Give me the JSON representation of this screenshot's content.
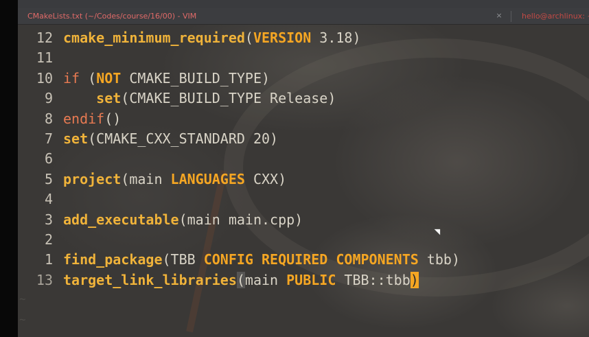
{
  "window": {
    "title": "CMakeLists.txt (~/Codes/course/16/00) - VIM",
    "close_icon": "×",
    "second_tab": "hello@archlinux: ~/Co"
  },
  "editor": {
    "lines": [
      {
        "num": "12",
        "tokens": [
          {
            "cls": "fn",
            "text": "cmake_minimum_required"
          },
          {
            "cls": "plain",
            "text": "("
          },
          {
            "cls": "kw",
            "text": "VERSION"
          },
          {
            "cls": "plain",
            "text": " 3.18)"
          }
        ]
      },
      {
        "num": "11",
        "tokens": []
      },
      {
        "num": "10",
        "tokens": [
          {
            "cls": "ifkw",
            "text": "if"
          },
          {
            "cls": "plain",
            "text": " ("
          },
          {
            "cls": "kw",
            "text": "NOT"
          },
          {
            "cls": "plain",
            "text": " CMAKE_BUILD_TYPE)"
          }
        ]
      },
      {
        "num": "9",
        "tokens": [
          {
            "cls": "plain",
            "text": "    "
          },
          {
            "cls": "fn",
            "text": "set"
          },
          {
            "cls": "plain",
            "text": "(CMAKE_BUILD_TYPE Release)"
          }
        ]
      },
      {
        "num": "8",
        "tokens": [
          {
            "cls": "ifkw",
            "text": "endif"
          },
          {
            "cls": "plain",
            "text": "()"
          }
        ]
      },
      {
        "num": "7",
        "tokens": [
          {
            "cls": "fn",
            "text": "set"
          },
          {
            "cls": "plain",
            "text": "(CMAKE_CXX_STANDARD 20)"
          }
        ]
      },
      {
        "num": "6",
        "tokens": []
      },
      {
        "num": "5",
        "tokens": [
          {
            "cls": "fn",
            "text": "project"
          },
          {
            "cls": "plain",
            "text": "(main "
          },
          {
            "cls": "kw",
            "text": "LANGUAGES"
          },
          {
            "cls": "plain",
            "text": " CXX)"
          }
        ]
      },
      {
        "num": "4",
        "tokens": []
      },
      {
        "num": "3",
        "tokens": [
          {
            "cls": "fn",
            "text": "add_executable"
          },
          {
            "cls": "plain",
            "text": "(main main.cpp)"
          }
        ]
      },
      {
        "num": "2",
        "tokens": []
      },
      {
        "num": "1",
        "tokens": [
          {
            "cls": "fn",
            "text": "find_package"
          },
          {
            "cls": "plain",
            "text": "(TBB "
          },
          {
            "cls": "kw",
            "text": "CONFIG"
          },
          {
            "cls": "plain",
            "text": " "
          },
          {
            "cls": "kw",
            "text": "REQUIRED"
          },
          {
            "cls": "plain",
            "text": " "
          },
          {
            "cls": "kw",
            "text": "COMPONENTS"
          },
          {
            "cls": "plain",
            "text": " tbb)"
          }
        ]
      },
      {
        "num": "13",
        "current": true,
        "tokens": [
          {
            "cls": "fn",
            "text": "target_link_libraries"
          },
          {
            "cls": "paren-hl",
            "text": "("
          },
          {
            "cls": "plain",
            "text": "main "
          },
          {
            "cls": "kw",
            "text": "PUBLIC"
          },
          {
            "cls": "plain",
            "text": " TBB::tbb"
          },
          {
            "cls": "cursor-box",
            "text": ")"
          }
        ]
      }
    ],
    "tilde_char": "~"
  },
  "colors": {
    "function": "#f0b33a",
    "keyword": "#f5a623",
    "control": "#e87a52",
    "text": "#d9d4c7",
    "title": "#e06a68"
  }
}
